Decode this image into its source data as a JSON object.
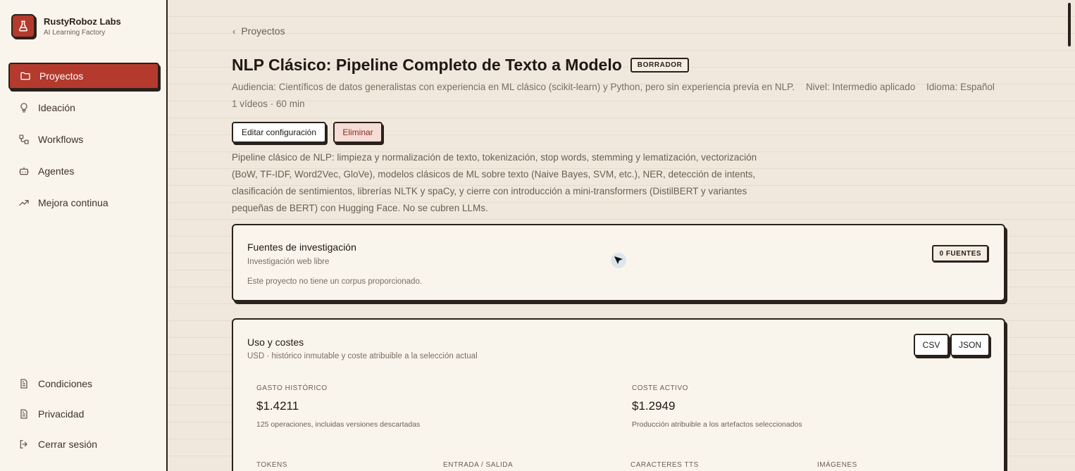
{
  "brand": {
    "name": "RustyRoboz Labs",
    "subtitle": "AI Learning Factory",
    "logo_icon": "flask-icon",
    "accent": "#b43a2d"
  },
  "sidebar": {
    "items": [
      {
        "label": "Proyectos",
        "icon": "folder-icon",
        "active": true
      },
      {
        "label": "Ideación",
        "icon": "lightbulb-icon"
      },
      {
        "label": "Workflows",
        "icon": "workflow-icon"
      },
      {
        "label": "Agentes",
        "icon": "bot-icon"
      },
      {
        "label": "Mejora continua",
        "icon": "trending-up-icon"
      }
    ],
    "footer": [
      {
        "label": "Condiciones",
        "icon": "document-icon"
      },
      {
        "label": "Privacidad",
        "icon": "document-icon"
      },
      {
        "label": "Cerrar sesión",
        "icon": "logout-icon"
      }
    ]
  },
  "breadcrumb": {
    "back_label": "Proyectos"
  },
  "project": {
    "title": "NLP Clásico: Pipeline Completo de Texto a Modelo",
    "status": "BORRADOR",
    "audience": "Audiencia: Científicos de datos generalistas con experiencia en ML clásico (scikit-learn) y Python, pero sin experiencia previa en NLP.",
    "level": "Nivel: Intermedio aplicado",
    "language": "Idioma: Español",
    "summary": "1 vídeos · 60 min",
    "edit_label": "Editar configuración",
    "delete_label": "Eliminar",
    "description": "Pipeline clásico de NLP: limpieza y normalización de texto, tokenización, stop words, stemming y lematización, vectorización (BoW, TF-IDF, Word2Vec, GloVe), modelos clásicos de ML sobre texto (Naive Bayes, SVM, etc.), NER, detección de intents, clasificación de sentimientos, librerías NLTK y spaCy, y cierre con introducción a mini-transformers (DistilBERT y variantes pequeñas de BERT) con Hugging Face. No se cubren LLMs."
  },
  "sources": {
    "title": "Fuentes de investigación",
    "subtitle": "Investigación web libre",
    "note": "Este proyecto no tiene un corpus proporcionado.",
    "count_badge": "0 FUENTES"
  },
  "costs": {
    "title": "Uso y costes",
    "subtitle": "USD · histórico inmutable y coste atribuible a la selección actual",
    "csv_label": "CSV",
    "json_label": "JSON",
    "historic_label": "GASTO HISTÓRICO",
    "historic_value": "$1.4211",
    "historic_note": "125 operaciones, incluidas versiones descartadas",
    "active_label": "COSTE ACTIVO",
    "active_value": "$1.2949",
    "active_note": "Producción atribuible a los artefactos seleccionados",
    "tokens_label": "TOKENS",
    "io_label": "ENTRADA / SALIDA",
    "tts_label": "CARACTERES TTS",
    "images_label": "IMÁGENES"
  }
}
